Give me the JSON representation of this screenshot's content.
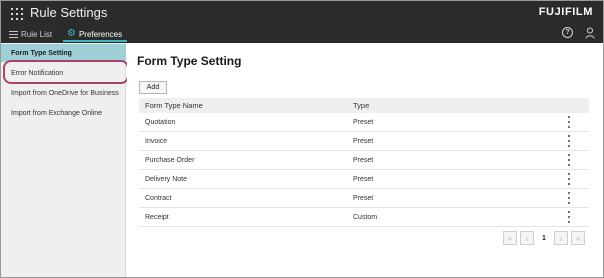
{
  "app": {
    "title": "Rule Settings",
    "brand": "FUJIFILM"
  },
  "tabs": [
    {
      "label": "Rule List",
      "icon": "list-icon"
    },
    {
      "label": "Preferences",
      "icon": "gear-icon"
    }
  ],
  "accent_color": "#3cb7c0",
  "sidebar": {
    "items": [
      {
        "label": "Form Type Setting"
      },
      {
        "label": "Error Notification"
      },
      {
        "label": "Import from OneDrive for Business"
      },
      {
        "label": "Import from Exchange Online"
      }
    ]
  },
  "main": {
    "title": "Form Type Setting",
    "add_label": "Add",
    "columns": [
      "Form Type Name",
      "Type"
    ],
    "rows": [
      {
        "name": "Quotation",
        "type": "Preset"
      },
      {
        "name": "Invoice",
        "type": "Preset"
      },
      {
        "name": "Purchase Order",
        "type": "Preset"
      },
      {
        "name": "Delivery Note",
        "type": "Preset"
      },
      {
        "name": "Contract",
        "type": "Preset"
      },
      {
        "name": "Receipt",
        "type": "Custom"
      }
    ],
    "pagination": {
      "first": "«",
      "prev": "‹",
      "current": "1",
      "next": "›",
      "last": "»"
    }
  }
}
